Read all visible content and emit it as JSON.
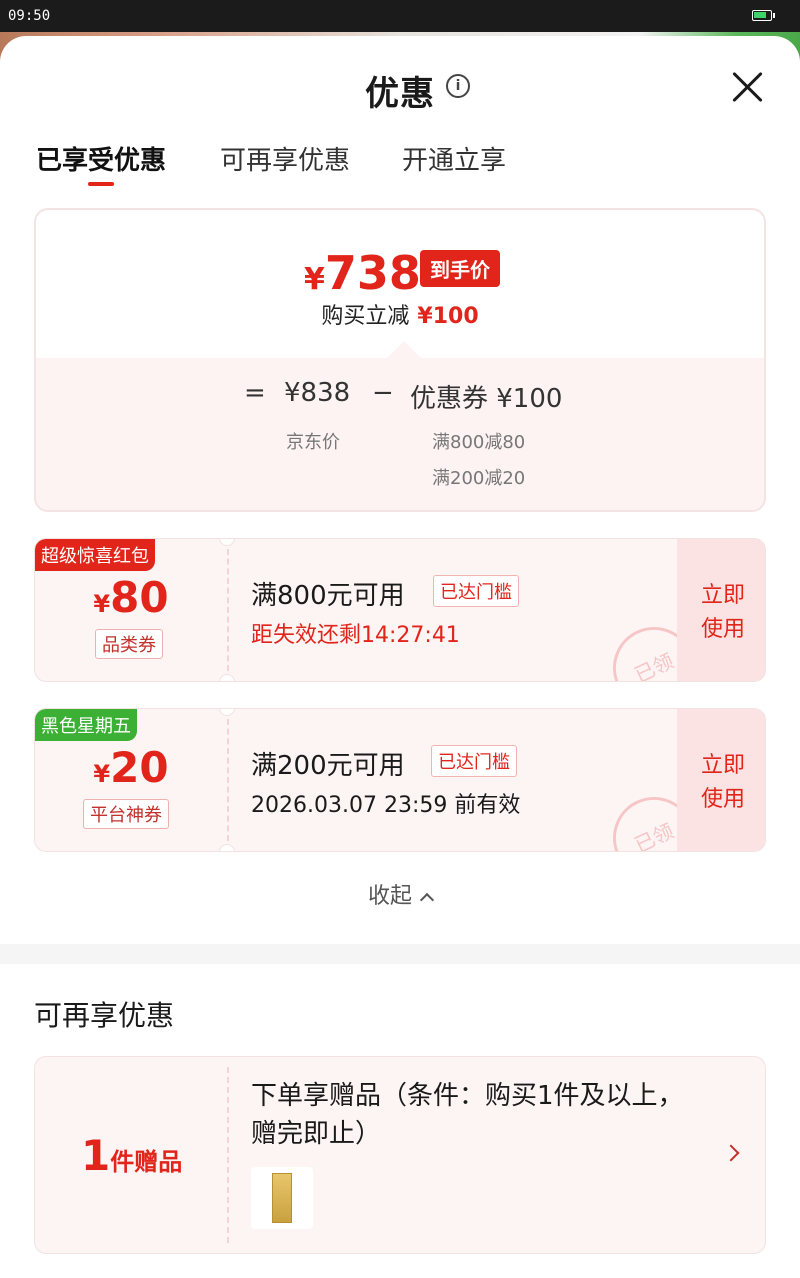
{
  "status_bar": {
    "time": "09:50",
    "battery_level": 0.8
  },
  "colors": {
    "accent": "#e1251b",
    "tag_red": "#e1251b",
    "tag_green": "#3cb034"
  },
  "header": {
    "title": "优惠",
    "info_icon": "info-circle-icon",
    "close_icon": "close-icon"
  },
  "tabs": [
    {
      "label": "已享受优惠",
      "active": true
    },
    {
      "label": "可再享优惠",
      "active": false
    },
    {
      "label": "开通立享",
      "active": false
    }
  ],
  "summary": {
    "yen": "¥",
    "final_price": "738",
    "final_badge": "到手价",
    "instant_label": "购买立减",
    "instant_amount": "¥100",
    "equals": "=",
    "jd_price": "¥838",
    "minus": "−",
    "coupon_label": "优惠券 ¥100",
    "jd_price_label": "京东价",
    "coupon_details": [
      "满800减80",
      "满200减20"
    ]
  },
  "coupons": [
    {
      "tag": "超级惊喜红包",
      "tag_color": "#e1251b",
      "yen": "¥",
      "amount": "80",
      "type": "品类券",
      "condition": "满800元可用",
      "reached": "已达门槛",
      "expire": "距失效还剩14:27:41",
      "expire_color": "#e1251b",
      "use": "立即使用",
      "stamp": "已领"
    },
    {
      "tag": "黑色星期五",
      "tag_color": "#3cb034",
      "yen": "¥",
      "amount": "20",
      "type": "平台神券",
      "condition": "满200元可用",
      "reached": "已达门槛",
      "expire": "2026.03.07 23:59 前有效",
      "expire_color": "#1a1a1a",
      "use": "立即使用",
      "stamp": "已领"
    }
  ],
  "collapse_label": "收起",
  "more_section": {
    "title": "可再享优惠",
    "gift": {
      "count": "1",
      "unit": "件赠品",
      "text": "下单享赠品（条件：购买1件及以上，赠完即止）"
    }
  }
}
